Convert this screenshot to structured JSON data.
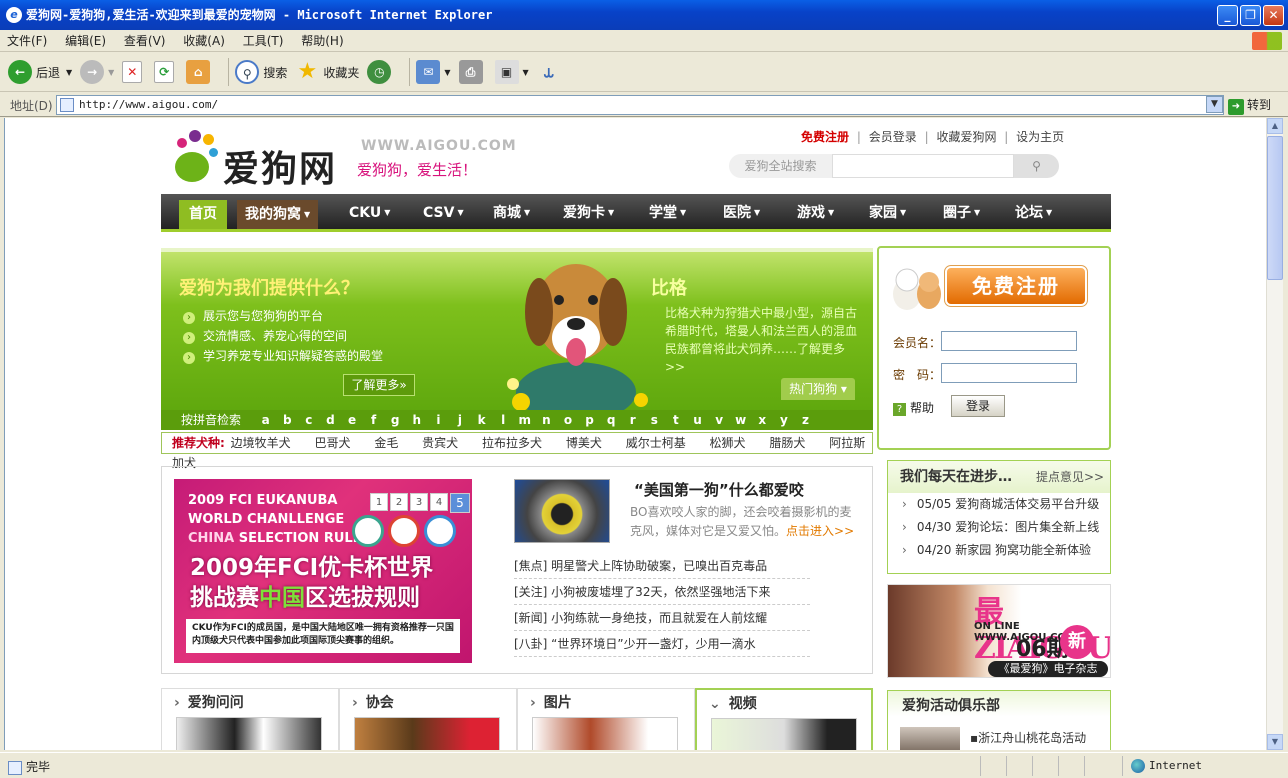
{
  "window": {
    "title": "爱狗网-爱狗狗,爱生活-欢迎来到最爱的宠物网 - Microsoft Internet Explorer",
    "controls": [
      "_",
      "❐",
      "✕"
    ]
  },
  "menu": [
    "文件(F)",
    "编辑(E)",
    "查看(V)",
    "收藏(A)",
    "工具(T)",
    "帮助(H)"
  ],
  "toolbar": {
    "back": "后退",
    "search": "搜索",
    "favorites": "收藏夹"
  },
  "address": {
    "label": "地址(D)",
    "url": "http://www.aigou.com/",
    "go": "转到"
  },
  "site": {
    "logo_cn": "爱狗网",
    "logo_en": "WWW.AIGOU.COM",
    "slogan": "爱狗狗，爱生活！",
    "toplinks": {
      "register": "免费注册",
      "login": "会员登录",
      "bookmark": "收藏爱狗网",
      "homepage": "设为主页"
    },
    "search_placeholder": "爱狗全站搜索",
    "nav": [
      "首页",
      "我的狗窝",
      "CKU",
      "CSV",
      "商城",
      "爱狗卡",
      "学堂",
      "医院",
      "游戏",
      "家园",
      "圈子",
      "论坛"
    ],
    "banner": {
      "question": "爱狗为我们提供什么？",
      "items": [
        "展示您与您狗狗的平台",
        "交流情感、养宠心得的空间",
        "学习养宠专业知识解疑答惑的殿堂"
      ],
      "more": "了解更多»",
      "breed": "比格",
      "desc": "比格犬种为狩猎犬中最小型，源自古希腊时代，塔曼人和法兰西人的混血民族都曾将此犬饲养……了解更多>>",
      "hot": "热门狗狗 ▾"
    },
    "alpha_label": "按拼音检索",
    "alpha": [
      "a",
      "b",
      "c",
      "d",
      "e",
      "f",
      "g",
      "h",
      "i",
      "j",
      "k",
      "l",
      "m",
      "n",
      "o",
      "p",
      "q",
      "r",
      "s",
      "t",
      "u",
      "v",
      "w",
      "x",
      "y",
      "z"
    ],
    "recommend_label": "推荐犬种:",
    "recommend": [
      "边境牧羊犬",
      "巴哥犬",
      "金毛",
      "贵宾犬",
      "拉布拉多犬",
      "博美犬",
      "威尔士柯基",
      "松狮犬",
      "腊肠犬",
      "阿拉斯加犬"
    ],
    "login": {
      "register_btn": "免费注册",
      "username_label": "会员名：",
      "password_label": "密　码：",
      "help": "帮助",
      "login_btn": "登录"
    },
    "fci": {
      "line1": "2009 FCI EUKANUBA",
      "line2": "WORLD CHANLLENGE",
      "line3a": "CHINA",
      "line3b": " SELECTION RULES",
      "pages": [
        "1",
        "2",
        "3",
        "4",
        "5"
      ],
      "big1": "2009年FCI优卡杯世界",
      "big2a": "挑战赛",
      "big2b": "中国",
      "big2c": "区选拔规则",
      "small": "CKU作为FCI的成员国，是中国大陆地区唯一拥有资格推荐一只国内顶级犬只代表中国参加此项国际顶尖赛事的组织。"
    },
    "headline": "“美国第一狗”什么都爱咬",
    "lead": "BO喜欢咬人家的脚，还会咬着摄影机的麦克风，媒体对它是又爱又怕。",
    "lead_enter": "点击进入>>",
    "news": [
      "[焦点] 明星警犬上阵协助破案，已嗅出百克毒品",
      "[关注] 小狗被废墟埋了32天，依然坚强地活下来",
      "[新闻] 小狗练就一身绝技，而且就爱在人前炫耀",
      "[八卦] “世界环境日”少开一盏灯，少用一滴水"
    ],
    "progress": {
      "title": "我们每天在进步…",
      "suggest": "提点意见>>",
      "items": [
        "05/05  爱狗商城活体交易平台升级",
        "04/30  爱狗论坛：图片集全新上线",
        "04/20  新家园 狗窝功能全新体验"
      ]
    },
    "ad": {
      "t1": "最ZIAIGOU",
      "t2": "ON LINE  WWW.AIGOU.COM",
      "issue": "06期",
      "new": "新",
      "caption": "《最爱狗》电子杂志"
    },
    "columns": [
      "爱狗问问",
      "协会",
      "图片",
      "视频"
    ],
    "club": {
      "title": "爱狗活动俱乐部",
      "item": "▪浙江舟山桃花岛活动"
    }
  },
  "status": {
    "text": "完毕",
    "zone": "Internet"
  },
  "colors": {
    "titlebar": "#0842c8",
    "nav_accent": "#9fcd2c",
    "register": "#d40000",
    "banner": "#7ec01c"
  }
}
